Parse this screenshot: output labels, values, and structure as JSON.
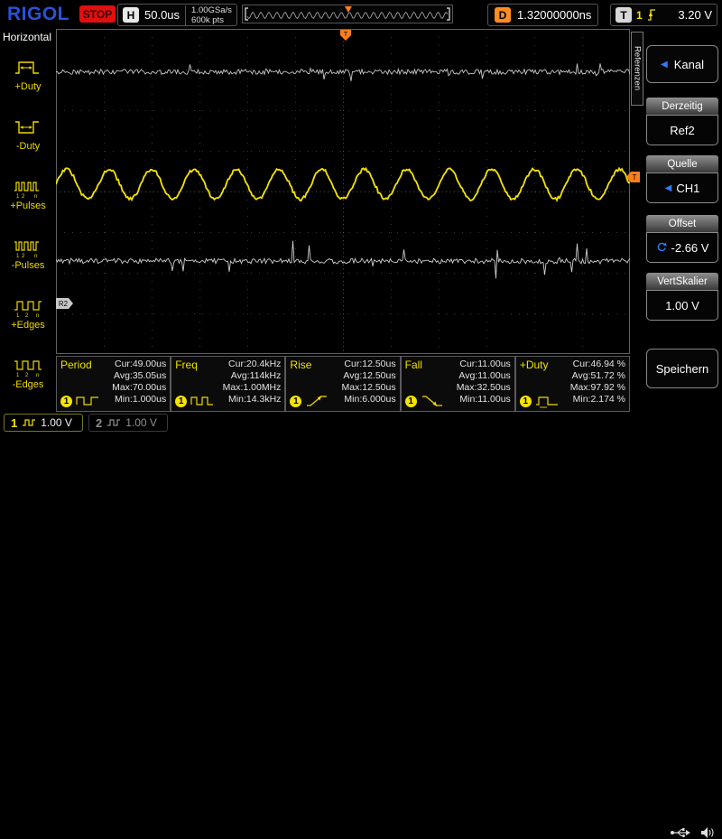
{
  "colors": {
    "trigger_orange": "#ff7d1e",
    "accent_yellow": "#f5e400",
    "logo_blue": "#2a52d8",
    "stop_red": "#e01010",
    "accent_blue": "#2e7bff",
    "ref_gray": "#c8c8c8"
  },
  "top_bar": {
    "logo": "RIGOL",
    "run_state": "STOP",
    "horizontal": {
      "badge": "H",
      "timebase": "50.0us",
      "sample_rate": "1.00GSa/s",
      "memory_depth": "600k pts"
    },
    "preview": {
      "cycles": 26
    },
    "delay": {
      "badge": "D",
      "value": "1.32000000ns"
    },
    "trigger": {
      "badge": "T",
      "source": "1",
      "level": "3.20 V"
    }
  },
  "sidebar": {
    "title": "Horizontal",
    "items": [
      {
        "label": "+Duty"
      },
      {
        "label": "-Duty"
      },
      {
        "label": "+Pulses"
      },
      {
        "label": "-Pulses"
      },
      {
        "label": "+Edges"
      },
      {
        "label": "-Edges"
      }
    ]
  },
  "scope": {
    "grid": {
      "cols": 12,
      "rows": 8
    },
    "trigger_marker_label": "T",
    "ref_marker": "R2",
    "trigger_position": 0.504,
    "trigger_level": 0.455,
    "ref_marker_pos": 0.845,
    "waveforms": [
      {
        "name": "channel2-noise-trace",
        "type": "noise",
        "color": "#c8c8c8",
        "baseline": 0.132,
        "amplitude": 0.008,
        "spike": 0.03
      },
      {
        "name": "channel1-sine-trace",
        "type": "sine",
        "color": "#f5e400",
        "baseline": 0.478,
        "amplitude": 0.046,
        "cycles": 13.5,
        "noise": 0.005
      },
      {
        "name": "ref2-noise-trace",
        "type": "noise",
        "color": "#cdcdcd",
        "baseline": 0.714,
        "amplitude": 0.008,
        "spike": 0.055
      }
    ]
  },
  "measurements": [
    {
      "name": "Period",
      "source": "1",
      "rows": [
        "Cur:49.00us",
        "Avg:35.05us",
        "Max:70.00us",
        "Min:1.000us"
      ]
    },
    {
      "name": "Freq",
      "source": "1",
      "rows": [
        "Cur:20.4kHz",
        "Avg:114kHz",
        "Max:1.00MHz",
        "Min:14.3kHz"
      ]
    },
    {
      "name": "Rise",
      "source": "1",
      "rows": [
        "Cur:12.50us",
        "Avg:12.50us",
        "Max:12.50us",
        "Min:6.000us"
      ]
    },
    {
      "name": "Fall",
      "source": "1",
      "rows": [
        "Cur:11.00us",
        "Avg:11.00us",
        "Max:32.50us",
        "Min:11.00us"
      ]
    },
    {
      "name": "+Duty",
      "source": "1",
      "rows": [
        "Cur:46.94 %",
        "Avg:51.72 %",
        "Max:97.92 %",
        "Min:2.174 %"
      ]
    }
  ],
  "right_menu": {
    "tab": "Referenzen",
    "back_label": "Kanal",
    "sections": [
      {
        "header": "Derzeitig",
        "value": "Ref2"
      },
      {
        "header": "Quelle",
        "value": "CH1"
      },
      {
        "header": "Offset",
        "value": "-2.66 V"
      },
      {
        "header": "VertSkalier",
        "value": "1.00 V"
      }
    ],
    "save_label": "Speichern"
  },
  "channel_bar": [
    {
      "number": "1",
      "scale": "1.00 V"
    },
    {
      "number": "2",
      "scale": "1.00 V"
    }
  ]
}
